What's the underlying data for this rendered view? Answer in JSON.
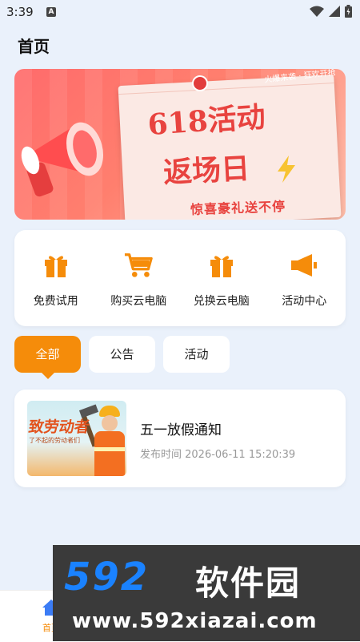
{
  "status_bar": {
    "time": "3:39",
    "notif_letter": "A"
  },
  "page_title": "首页",
  "banner": {
    "line1": "618活动",
    "line2": "返场日",
    "subtitle": "惊喜豪礼送不停",
    "ribbon": "火爆来袭 · 狂欢开抢"
  },
  "actions": [
    {
      "label": "免费试用",
      "icon": "gift-icon"
    },
    {
      "label": "购买云电脑",
      "icon": "cart-icon"
    },
    {
      "label": "兑换云电脑",
      "icon": "gift-icon"
    },
    {
      "label": "活动中心",
      "icon": "megaphone-icon"
    }
  ],
  "tabs": [
    {
      "label": "全部",
      "active": true
    },
    {
      "label": "公告",
      "active": false
    },
    {
      "label": "活动",
      "active": false
    }
  ],
  "notice": {
    "title": "五一放假通知",
    "time": "发布时间 2026-06-11 15:20:39",
    "thumb_title": "致劳动者",
    "thumb_sub": "了不起的劳动者们"
  },
  "bottom_nav": {
    "home_label": "首页"
  },
  "watermark": {
    "brand_num": "592",
    "brand_cn": "软件园",
    "url": "www.592xiazai.com"
  },
  "colors": {
    "accent": "#f58c0a",
    "banner_red": "#e8433f",
    "brand_blue": "#1a82ff"
  }
}
